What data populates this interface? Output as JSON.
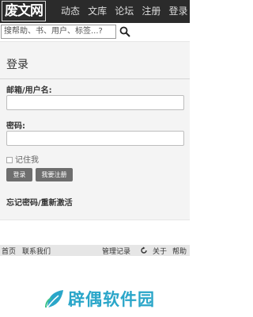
{
  "header": {
    "logo": "废文网",
    "nav": [
      "动态",
      "文库",
      "论坛",
      "注册",
      "登录"
    ]
  },
  "search": {
    "placeholder": "搜帮助、书、用户、标签...?"
  },
  "login": {
    "title": "登录",
    "username_label": "邮箱/用户名:",
    "password_label": "密码:",
    "remember_label": "记住我",
    "login_button": "登录",
    "register_button": "我要注册",
    "forgot_link": "忘记密码/重新激活"
  },
  "footer": {
    "home": "首页",
    "contact": "联系我们",
    "admin_log": "管理记录",
    "about": "关于",
    "help": "帮助"
  },
  "watermark": {
    "text": "辟偶软件园"
  },
  "colors": {
    "topbar": "#2b2b2b",
    "panel": "#f4f4f4",
    "button": "#6e6e6e",
    "brand": "#2aa6c9"
  }
}
